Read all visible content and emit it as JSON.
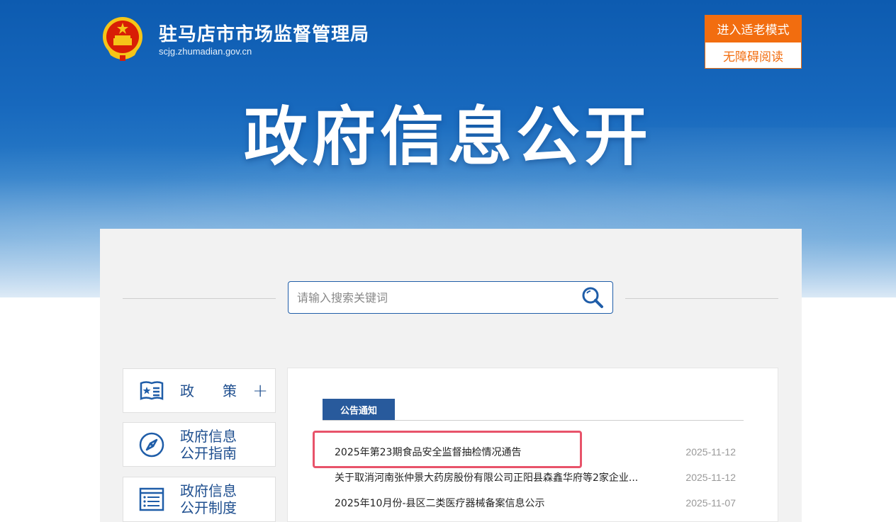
{
  "header": {
    "site_name": "驻马店市市场监督管理局",
    "site_domain": "scjg.zhumadian.gov.cn",
    "elder_mode_button": "进入适老模式",
    "accessibility_button": "无障碍阅读",
    "hero_title": "政府信息公开"
  },
  "search": {
    "placeholder": "请输入搜索关键词"
  },
  "sidebar": {
    "items": [
      {
        "label": "政策",
        "icon": "policy-star-icon",
        "expandable": true
      },
      {
        "label_line1": "政府信息",
        "label_line2": "公开指南",
        "icon": "compass-icon"
      },
      {
        "label_line1": "政府信息",
        "label_line2": "公开制度",
        "icon": "list-document-icon"
      }
    ]
  },
  "notices": {
    "tab_label": "公告通知",
    "items": [
      {
        "title": "2025年第23期食品安全监督抽检情况通告",
        "date": "2025-11-12"
      },
      {
        "title": "关于取消河南张仲景大药房股份有限公司正阳县森鑫华府等2家企业...",
        "date": "2025-11-12"
      },
      {
        "title": "2025年10月份-县区二类医疗器械备案信息公示",
        "date": "2025-11-07"
      }
    ]
  },
  "colors": {
    "brand_blue": "#1f5da8",
    "accent_orange": "#f26d0f",
    "highlight_red": "#e8536a"
  }
}
